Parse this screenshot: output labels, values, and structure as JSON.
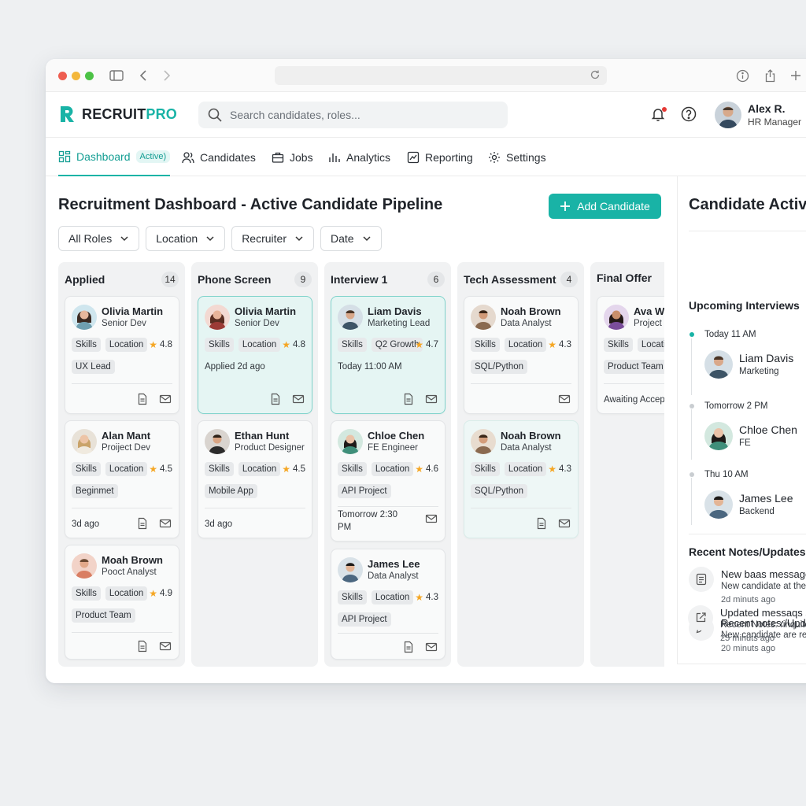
{
  "app": {
    "brand_main": "RECRUIT",
    "brand_accent": "PRO",
    "accent_color": "#19b3a6"
  },
  "search": {
    "placeholder": "Search candidates, roles..."
  },
  "user": {
    "name": "Alex R.",
    "role": "HR Manager"
  },
  "nav": {
    "dashboard": "Dashboard",
    "active_badge": "Active)",
    "candidates": "Candidates",
    "jobs": "Jobs",
    "analytics": "Analytics",
    "reporting": "Reporting",
    "settings": "Settings"
  },
  "main": {
    "title": "Recruitment Dashboard - Active Candidate Pipeline",
    "add_button": "Add Candidate",
    "filters": [
      "All Roles",
      "Location",
      "Recruiter",
      "Date"
    ]
  },
  "columns": [
    {
      "title": "Applied",
      "count": "14",
      "cards": [
        {
          "name": "Olivia Martin",
          "role": "Senior Dev",
          "tags": [
            "Skills",
            "Location"
          ],
          "rating": "4.8",
          "tag2": "UX Lead"
        },
        {
          "name": "Alan Mant",
          "role": "Proiject Dev",
          "tags": [
            "Skills",
            "Location"
          ],
          "rating": "4.5",
          "tag2": "Beginmet",
          "note": "3d ago"
        },
        {
          "name": "Moah Brown",
          "role": "Pooct Analyst",
          "tags": [
            "Skills",
            "Location"
          ],
          "rating": "4.9",
          "tag2": "Product Team"
        }
      ]
    },
    {
      "title": "Phone Screen",
      "count": "9",
      "cards": [
        {
          "name": "Olivia Martin",
          "role": "Senior Dev",
          "tags": [
            "Skills",
            "Location"
          ],
          "rating": "4.8",
          "note": "Applied 2d ago"
        },
        {
          "name": "Ethan Hunt",
          "role": "Product Designer",
          "tags": [
            "Skills",
            "Location"
          ],
          "rating": "4.5",
          "tag2": "Mobile App",
          "note": "3d ago"
        }
      ]
    },
    {
      "title": "Interview 1",
      "count": "6",
      "cards": [
        {
          "name": "Liam Davis",
          "role": "Marketing Lead",
          "tags": [
            "Skills",
            "Q2 Growth"
          ],
          "rating": "4.7",
          "note": "Today 11:00 AM"
        },
        {
          "name": "Chloe Chen",
          "role": "FE Engineer",
          "tags": [
            "Skills",
            "Location"
          ],
          "rating": "4.6",
          "tag2": "API Project",
          "note_line1": "Tomorrow 2:30",
          "note_line2": "PM"
        },
        {
          "name": "James Lee",
          "role": "Data Analyst",
          "tags": [
            "Skills",
            "Location"
          ],
          "rating": "4.3",
          "tag2": "API Project"
        }
      ]
    },
    {
      "title": "Tech Assessment",
      "count": "4",
      "cards": [
        {
          "name": "Noah Brown",
          "role": "Data Analyst",
          "tags": [
            "Skills",
            "Location"
          ],
          "rating": "4.3",
          "tag2": "SQL/Python"
        },
        {
          "name": "Noah Brown",
          "role": "Data Analyst",
          "tags": [
            "Skills",
            "Location"
          ],
          "rating": "4.3",
          "tag2": "SQL/Python"
        }
      ]
    },
    {
      "title": "Final Offer",
      "cards": [
        {
          "name": "Ava Wil",
          "role": "Project M",
          "tags": [
            "Skills",
            "Locatio"
          ],
          "tag2": "Product Team",
          "note": "Awaiting Accept"
        }
      ]
    }
  ],
  "panel": {
    "title": "Candidate Activit",
    "upcoming_title": "Upcoming Interviews",
    "interviews": [
      {
        "time": "Today 11 AM",
        "name": "Liam Davis",
        "role": "Marketing"
      },
      {
        "time": "Tomorrow 2 PM",
        "name": "Chloe Chen",
        "role": "FE"
      },
      {
        "time": "Thu 10 AM",
        "name": "James Lee",
        "role": "Backend"
      }
    ],
    "notes_title": "Recent Notes/Updates",
    "notes": [
      {
        "title": "New baas message",
        "body": "New candidate at the",
        "time": "2d minuts ago",
        "icon": "list-icon"
      },
      {
        "title": "Recent notes:/Upda",
        "body": "New candidate are re",
        "time": "20 minuts ago",
        "icon": "pencil-icon"
      },
      {
        "title": "Updated messaqs s",
        "body": "Recent Notes: rinquite",
        "time": "25 minuts ago",
        "icon": "external-link-icon"
      }
    ]
  }
}
